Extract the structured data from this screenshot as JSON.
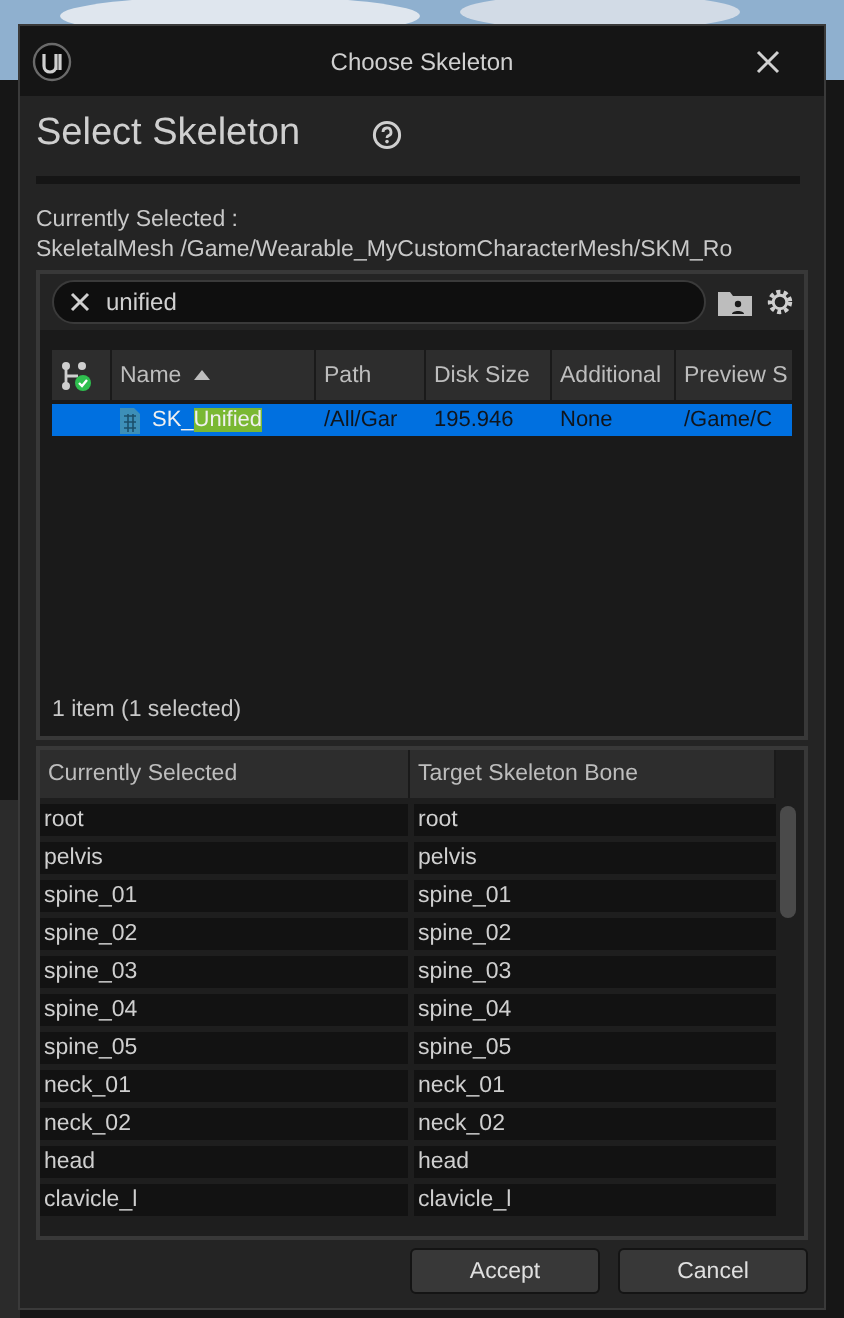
{
  "window": {
    "title": "Choose Skeleton"
  },
  "header": {
    "title": "Select Skeleton"
  },
  "current": {
    "label": "Currently Selected :",
    "path": "SkeletalMesh /Game/Wearable_MyCustomCharacterMesh/SKM_Ro"
  },
  "search": {
    "value": "unified"
  },
  "asset_table": {
    "columns": [
      "Name",
      "Path",
      "Disk Size",
      "Additional",
      "Preview S"
    ],
    "rows": [
      {
        "selected": true,
        "cells": [
          {
            "prefix": "SK_",
            "match": "Unified"
          },
          "/All/Gar",
          "195.946",
          "None",
          "/Game/C"
        ]
      }
    ]
  },
  "status": "1 item (1 selected)",
  "bone_table": {
    "columns": [
      "Currently Selected",
      "Target Skeleton Bone"
    ],
    "rows": [
      [
        "root",
        "root"
      ],
      [
        "pelvis",
        "pelvis"
      ],
      [
        "spine_01",
        "spine_01"
      ],
      [
        "spine_02",
        "spine_02"
      ],
      [
        "spine_03",
        "spine_03"
      ],
      [
        "spine_04",
        "spine_04"
      ],
      [
        "spine_05",
        "spine_05"
      ],
      [
        "neck_01",
        "neck_01"
      ],
      [
        "neck_02",
        "neck_02"
      ],
      [
        "head",
        "head"
      ],
      [
        "clavicle_l",
        "clavicle_l"
      ]
    ]
  },
  "buttons": [
    "Accept",
    "Cancel"
  ]
}
